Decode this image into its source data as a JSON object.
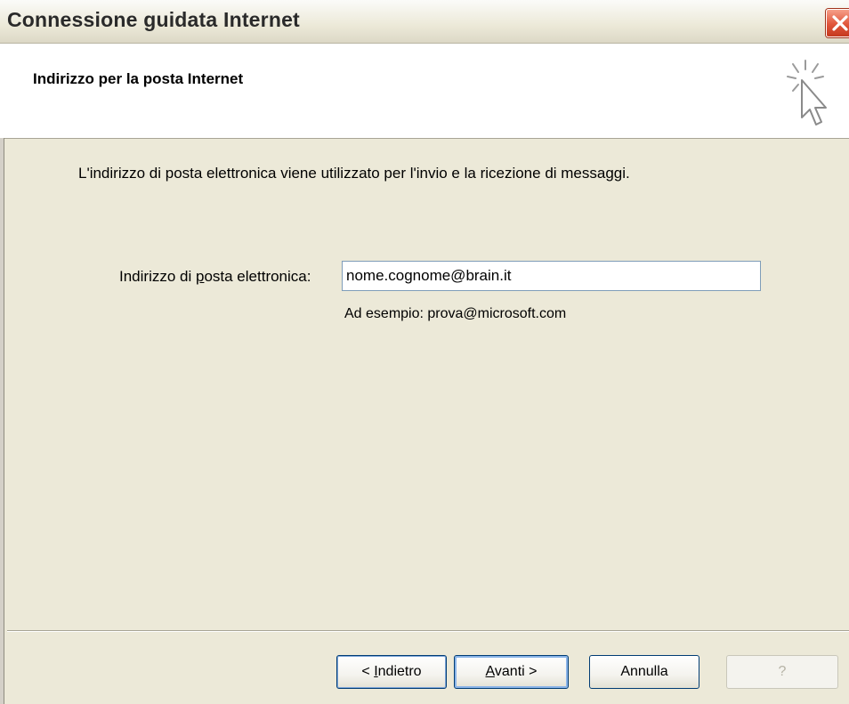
{
  "window": {
    "title": "Connessione guidata Internet",
    "close_symbol": "✕"
  },
  "header": {
    "title": "Indirizzo per la posta Internet",
    "icon": "wizard-cursor-icon"
  },
  "main": {
    "instruction": "L'indirizzo di posta elettronica viene utilizzato per l'invio e la ricezione di messaggi.",
    "email_label": "Indirizzo di posta elettronica:",
    "email_value": "nome.cognome@brain.it",
    "example": "Ad esempio: prova@microsoft.com"
  },
  "buttons": {
    "back": "< Indietro",
    "next": "Avanti >",
    "cancel": "Annulla",
    "help": "?"
  },
  "colors": {
    "dialog_bg": "#ece9d8",
    "close_button": "#e0553a",
    "input_border": "#7f9db9",
    "button_border": "#003c74"
  }
}
